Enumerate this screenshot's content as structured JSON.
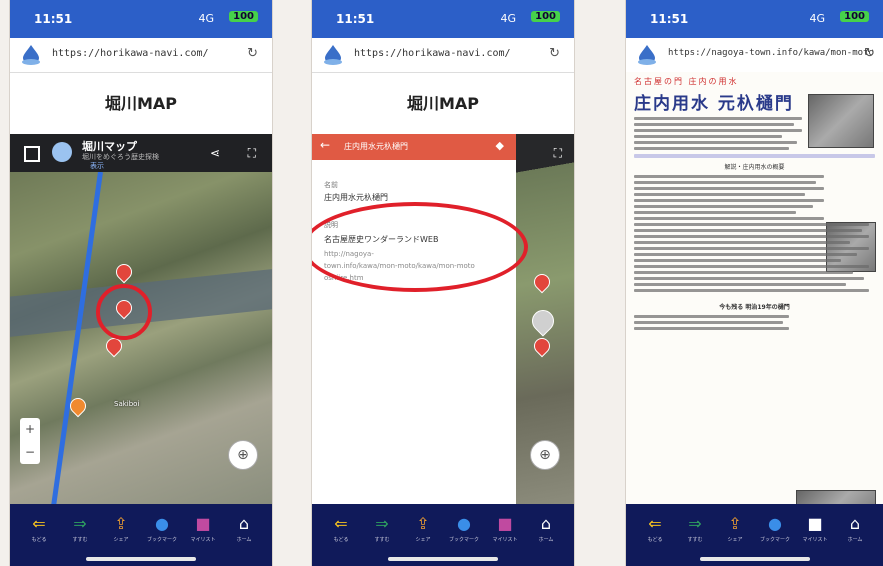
{
  "colors": {
    "status_bar": "#2c5fc8",
    "bottom_bar": "#101a5a",
    "panel_header": "#e05a44",
    "circle": "#e0202a"
  },
  "screen1": {
    "status": {
      "time": "11:51",
      "signal": "4G",
      "battery": "100"
    },
    "url": "https://horikawa-navi.com/",
    "title": "堀川MAP",
    "map_header": {
      "name": "堀川マップ",
      "subtitle": "堀川をめぐろう歴史探検",
      "views": "表示"
    },
    "map_label": "Sakiboi"
  },
  "screen2": {
    "status": {
      "time": "11:51",
      "signal": "4G",
      "battery": "100"
    },
    "url": "https://horikawa-navi.com/",
    "title": "堀川MAP",
    "panel_title": "庄内用水元杁樋門",
    "name_label": "名前",
    "name_value": "庄内用水元杁樋門",
    "desc_label": "説明",
    "desc_title": "名古屋歴史ワンダーランドWEB",
    "desc_url_lines": [
      "http://nagoya-",
      "town.info/kawa/mon-moto/kawa/mon-moto",
      "oshiire.htm"
    ]
  },
  "screen3": {
    "status": {
      "time": "11:51",
      "signal": "4G",
      "battery": "100"
    },
    "url": "https://nagoya-town.info/kawa/mon-moto",
    "kicker": "名古屋の門 庄内の用水",
    "headline": "庄内用水 元杁樋門",
    "section1": "解説・庄内用水の概要",
    "section2": "今も残る 明治19年の樋門"
  },
  "bottom_nav": [
    {
      "icon": "back-arrow-icon",
      "glyph": "⇐",
      "label": "もどる"
    },
    {
      "icon": "forward-arrow-icon",
      "glyph": "⇒",
      "label": "すすむ"
    },
    {
      "icon": "share-icon",
      "glyph": "⇪",
      "label": "シェア"
    },
    {
      "icon": "drop-icon",
      "glyph": "●",
      "label": "ブックマーク"
    },
    {
      "icon": "bookmark-icon",
      "glyph": "■",
      "label": "マイリスト"
    },
    {
      "icon": "home-icon",
      "glyph": "⌂",
      "label": "ホーム"
    }
  ]
}
